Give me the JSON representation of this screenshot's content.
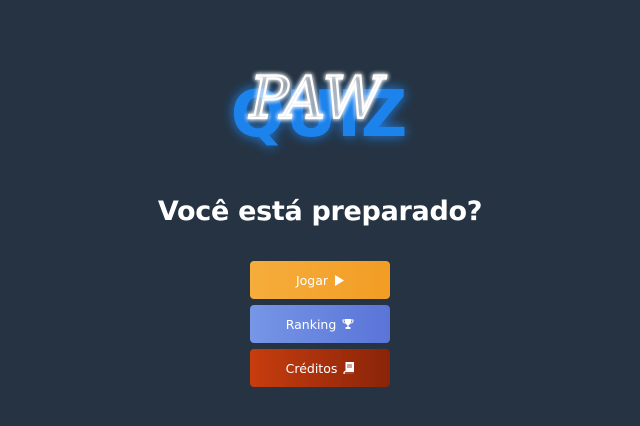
{
  "logo": {
    "script_text": "PAW",
    "block_text": "QUIZ",
    "neon_color": "#1f8bff",
    "glow_color": "#2f7dff"
  },
  "headline": "Você está preparado?",
  "menu": {
    "play": {
      "label": "Jogar",
      "icon": "play-icon",
      "color": "#f4a62e"
    },
    "ranking": {
      "label": "Ranking",
      "icon": "trophy-icon",
      "color": "#6a86df"
    },
    "credits": {
      "label": "Créditos",
      "icon": "book-icon",
      "color": "#b7350d"
    }
  }
}
